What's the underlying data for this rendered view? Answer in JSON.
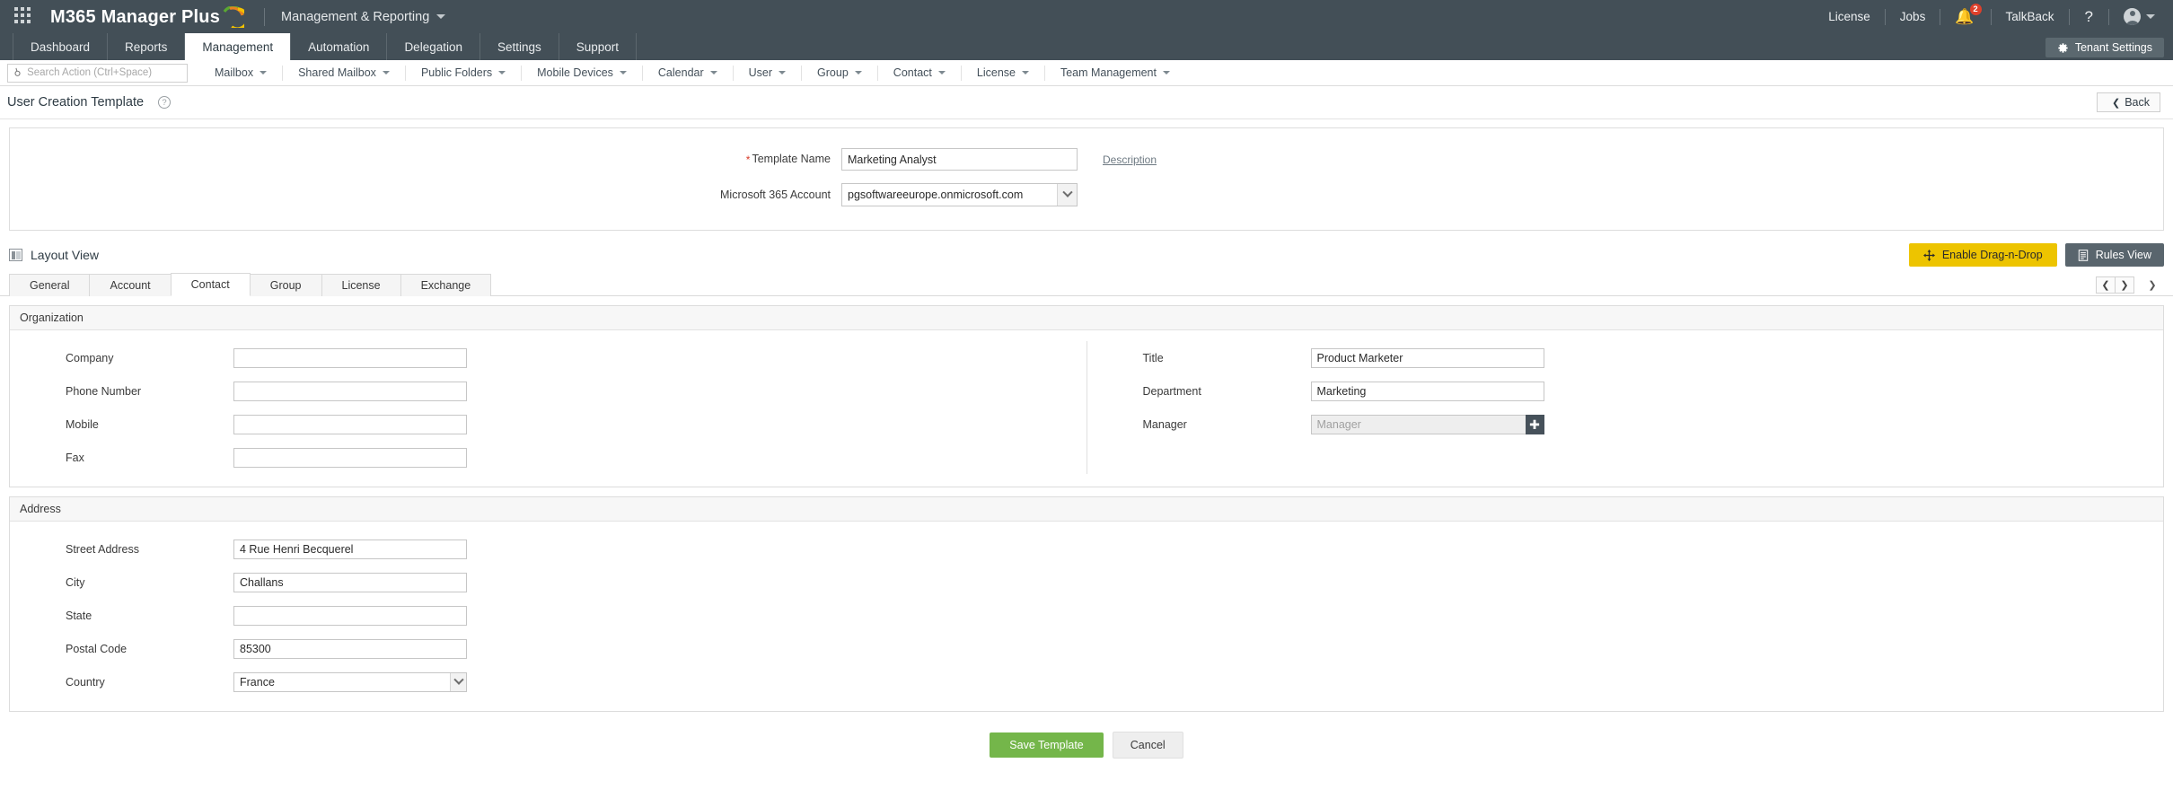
{
  "topbar": {
    "brand": "M365 Manager Plus",
    "module": "Management & Reporting",
    "license": "License",
    "jobs": "Jobs",
    "notification_count": "2",
    "talkback": "TalkBack",
    "help": "?",
    "waffle_icon": "apps-grid-icon",
    "bell_icon": "bell-icon",
    "avatar_icon": "user-avatar-icon"
  },
  "nav": {
    "tabs": [
      {
        "label": "Dashboard",
        "active": false
      },
      {
        "label": "Reports",
        "active": false
      },
      {
        "label": "Management",
        "active": true
      },
      {
        "label": "Automation",
        "active": false
      },
      {
        "label": "Delegation",
        "active": false
      },
      {
        "label": "Settings",
        "active": false
      },
      {
        "label": "Support",
        "active": false
      }
    ],
    "tenant_settings": "Tenant Settings",
    "tenant_settings_icon": "gear-icon"
  },
  "subnav": {
    "search_placeholder": "Search Action (Ctrl+Space)",
    "search_value": "",
    "search_icon": "search-icon",
    "items": [
      "Mailbox",
      "Shared Mailbox",
      "Public Folders",
      "Mobile Devices",
      "Calendar",
      "User",
      "Group",
      "Contact",
      "License",
      "Team Management"
    ]
  },
  "page": {
    "title": "User Creation Template",
    "help_icon": "question-circle-icon",
    "back_label": "Back",
    "back_icon": "chevron-left-icon"
  },
  "top_form": {
    "template_name_label": "Template Name",
    "template_name_value": "Marketing Analyst",
    "template_name_required": true,
    "description_link": "Description",
    "account_label": "Microsoft 365 Account",
    "account_value": "pgsoftwareeurope.onmicrosoft.com"
  },
  "layout_bar": {
    "title": "Layout View",
    "layout_icon": "layout-panel-icon",
    "drag_drop_label": "Enable Drag-n-Drop",
    "drag_drop_icon": "move-arrows-icon",
    "rules_view_label": "Rules View",
    "rules_view_icon": "document-icon",
    "accent_yellow": "#edc400",
    "accent_grey": "#59656d"
  },
  "tabs": {
    "items": [
      {
        "label": "General",
        "active": false
      },
      {
        "label": "Account",
        "active": false
      },
      {
        "label": "Contact",
        "active": true
      },
      {
        "label": "Group",
        "active": false
      },
      {
        "label": "License",
        "active": false
      },
      {
        "label": "Exchange",
        "active": false
      }
    ],
    "prev_icon": "chevron-left-icon",
    "next_icon": "chevron-right-icon",
    "more_icon": "chevron-down-icon"
  },
  "sections": [
    {
      "title": "Organization",
      "left_fields": [
        {
          "label": "Company",
          "value": "",
          "type": "text"
        },
        {
          "label": "Phone Number",
          "value": "",
          "type": "text"
        },
        {
          "label": "Mobile",
          "value": "",
          "type": "text"
        },
        {
          "label": "Fax",
          "value": "",
          "type": "text"
        }
      ],
      "right_fields": [
        {
          "label": "Title",
          "value": "Product Marketer",
          "type": "text"
        },
        {
          "label": "Department",
          "value": "Marketing",
          "type": "text"
        },
        {
          "label": "Manager",
          "value": "",
          "placeholder": "Manager",
          "type": "picker",
          "disabled": true,
          "button_icon": "plus-icon"
        }
      ]
    },
    {
      "title": "Address",
      "left_fields": [
        {
          "label": "Street Address",
          "value": "4 Rue Henri Becquerel",
          "type": "text"
        },
        {
          "label": "City",
          "value": "Challans",
          "type": "text"
        },
        {
          "label": "State",
          "value": "",
          "type": "text"
        },
        {
          "label": "Postal Code",
          "value": "85300",
          "type": "text"
        },
        {
          "label": "Country",
          "value": "France",
          "type": "select"
        }
      ],
      "right_fields": []
    }
  ],
  "footer": {
    "save_label": "Save Template",
    "cancel_label": "Cancel",
    "save_color": "#74b64a"
  }
}
